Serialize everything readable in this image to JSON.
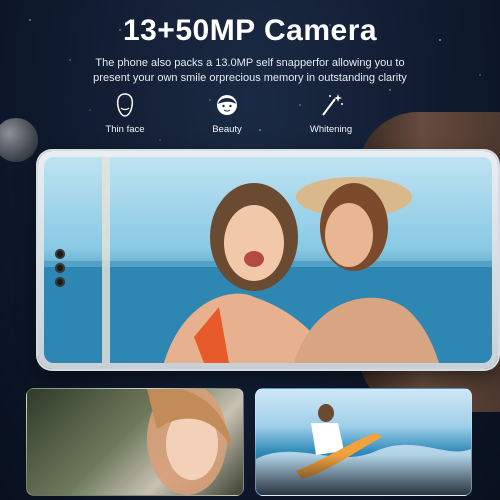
{
  "header": {
    "title": "13+50MP Camera",
    "subtitle_line1": "The phone also packs a 13.0MP self snapperfor allowing you to",
    "subtitle_line2": "present your own smile orprecious memory in outstanding clarity"
  },
  "features": [
    {
      "label": "Thin face",
      "icon": "face-outline-icon"
    },
    {
      "label": "Beauty",
      "icon": "beauty-face-icon"
    },
    {
      "label": "Whitening",
      "icon": "magic-wand-icon"
    }
  ],
  "colors": {
    "background": "#0f1a2e",
    "text": "#ffffff",
    "phone_frame": "#e9eef2"
  }
}
